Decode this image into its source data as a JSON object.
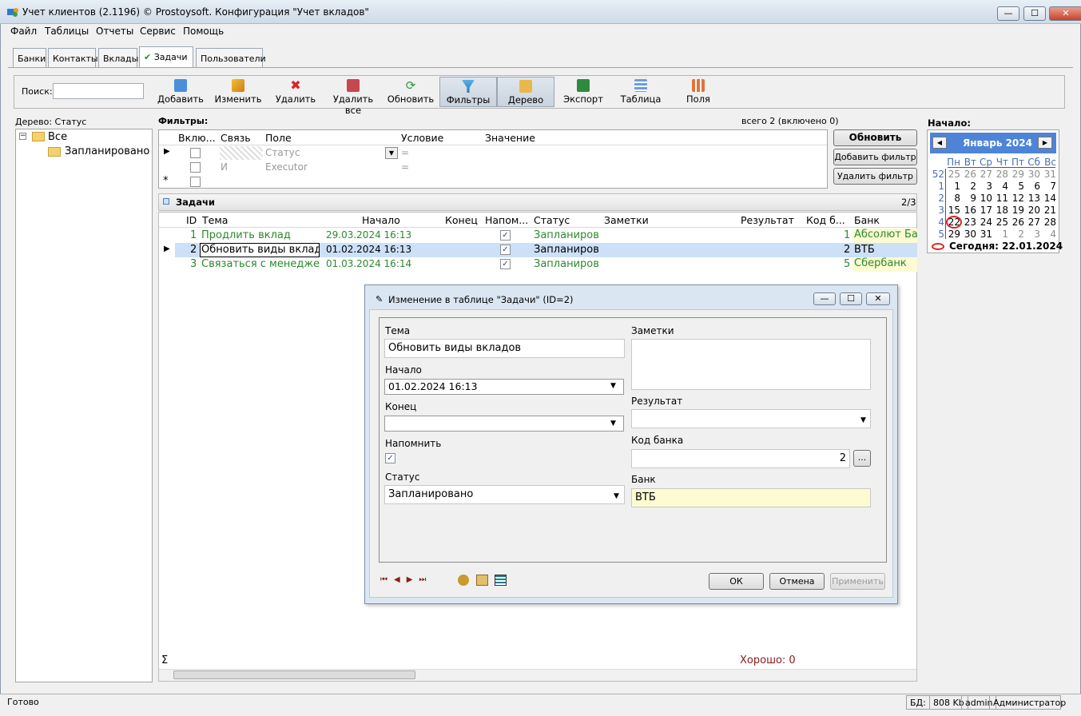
{
  "window": {
    "title": "Учет клиентов (2.1196) © Prostoysoft. Конфигурация \"Учет вкладов\"",
    "min": "—",
    "max": "☐",
    "close": "✕"
  },
  "menu": [
    "Файл",
    "Таблицы",
    "Отчеты",
    "Сервис",
    "Помощь"
  ],
  "tabs": [
    "Банки",
    "Контакты",
    "Вклады",
    "Задачи",
    "Пользователи"
  ],
  "active_tab_mark": "✔",
  "search": {
    "label": "Поиск:",
    "value": ""
  },
  "toolbar": [
    "Добавить",
    "Изменить",
    "Удалить",
    "Удалить все",
    "Обновить",
    "Фильтры",
    "Дерево",
    "Экспорт",
    "Таблица",
    "Поля"
  ],
  "tree": {
    "title": "Дерево: Статус",
    "root": "Все",
    "child": "Запланировано"
  },
  "filters": {
    "title": "Фильтры:",
    "total": "всего 2 (включено 0)",
    "headers": [
      "Вклю...",
      "Связь",
      "Поле",
      "Условие",
      "Значение"
    ],
    "rows": [
      {
        "link": "",
        "field": "Статус",
        "cond": "="
      },
      {
        "link": "И",
        "field": "Executor",
        "cond": "="
      }
    ],
    "buttons": [
      "Обновить",
      "Добавить фильтр",
      "Удалить фильтр"
    ]
  },
  "tasks": {
    "title": "Задачи",
    "page": "2/3",
    "headers": [
      "ID",
      "Тема",
      "Начало",
      "Конец",
      "Напом...",
      "Статус",
      "Заметки",
      "Результат",
      "Код б...",
      "Банк"
    ],
    "rows": [
      {
        "id": "1",
        "topic": "Продлить вклад",
        "start": "29.03.2024 16:13",
        "status": "Запланиров",
        "code": "1",
        "bank": "Абсолют Бан"
      },
      {
        "id": "2",
        "topic": "Обновить виды вкладов",
        "start": "01.02.2024 16:13",
        "status": "Запланиров",
        "code": "2",
        "bank": "ВТБ"
      },
      {
        "id": "3",
        "topic": "Связаться с менеджером",
        "start": "01.03.2024 16:14",
        "status": "Запланиров",
        "code": "5",
        "bank": "Сбербанк"
      }
    ],
    "sigma": "Σ",
    "footer_result": "Хорошо: 0"
  },
  "dialog": {
    "title": "Изменение в таблице \"Задачи\" (ID=2)",
    "topic_label": "Тема",
    "topic_value": "Обновить виды вкладов",
    "start_label": "Начало",
    "start_value": "01.02.2024 16:13",
    "end_label": "Конец",
    "end_value": "",
    "remind_label": "Напомнить",
    "status_label": "Статус",
    "status_value": "Запланировано",
    "notes_label": "Заметки",
    "result_label": "Результат",
    "result_value": "",
    "code_label": "Код банка",
    "code_value": "2",
    "code_btn": "...",
    "bank_label": "Банк",
    "bank_value": "ВТБ",
    "ok": "ОК",
    "cancel": "Отмена",
    "apply": "Применить"
  },
  "calendar": {
    "title": "Начало:",
    "month": "Январь 2024",
    "weekdays": [
      "Пн",
      "Вт",
      "Ср",
      "Чт",
      "Пт",
      "Сб",
      "Вс"
    ],
    "weeks": [
      [
        "52",
        "25",
        "26",
        "27",
        "28",
        "29",
        "30",
        "31"
      ],
      [
        "1",
        "1",
        "2",
        "3",
        "4",
        "5",
        "6",
        "7"
      ],
      [
        "2",
        "8",
        "9",
        "10",
        "11",
        "12",
        "13",
        "14"
      ],
      [
        "3",
        "15",
        "16",
        "17",
        "18",
        "19",
        "20",
        "21"
      ],
      [
        "4",
        "22",
        "23",
        "24",
        "25",
        "26",
        "27",
        "28"
      ],
      [
        "5",
        "29",
        "30",
        "31",
        "1",
        "2",
        "3",
        "4"
      ]
    ],
    "today": "Сегодня: 22.01.2024"
  },
  "status": {
    "ready": "Готово",
    "db": "БД:",
    "size": "808 Kb",
    "user": "admin",
    "role": "Администратор"
  }
}
